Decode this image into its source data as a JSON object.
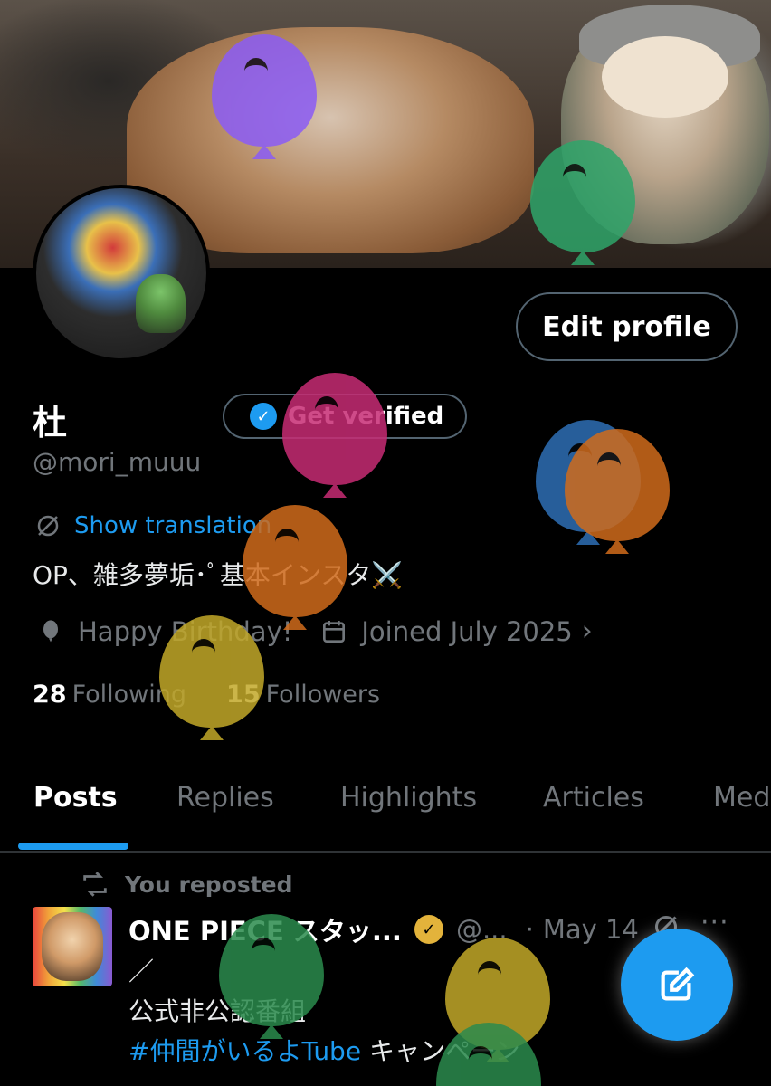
{
  "profile": {
    "name": "杜",
    "handle": "@mori_muuu",
    "edit_label": "Edit profile",
    "get_verified_label": "Get verified",
    "translation_label": "Show translation",
    "bio": "OP、雑多夢垢･ﾟ基本インスタ⚔️",
    "birthday": "Happy Birthday!",
    "joined": "Joined July 2025",
    "following_count": "28",
    "following_label": "Following",
    "followers_count": "15",
    "followers_label": "Followers"
  },
  "tabs": [
    {
      "label": "Posts"
    },
    {
      "label": "Replies"
    },
    {
      "label": "Highlights"
    },
    {
      "label": "Articles"
    },
    {
      "label": "Med"
    }
  ],
  "post": {
    "repost_label": "You reposted",
    "author": "ONE PIECE スタッ...",
    "handle": "@...",
    "separator": "·",
    "date": "May 14",
    "more": "···",
    "line1": "／",
    "line2": "公式非公認番組",
    "hashtag": "#仲間がいるよTube",
    "line3_rest": " キャンペーン"
  },
  "colors": {
    "accent": "#1d9bf0",
    "balloons": [
      "#8b5cf6",
      "#2fa56a",
      "#c72c74",
      "#2e6fb5",
      "#d06b1c",
      "#d06b1c",
      "#c2a829",
      "#2b8b4d",
      "#c2a829",
      "#2b8b4d"
    ]
  }
}
